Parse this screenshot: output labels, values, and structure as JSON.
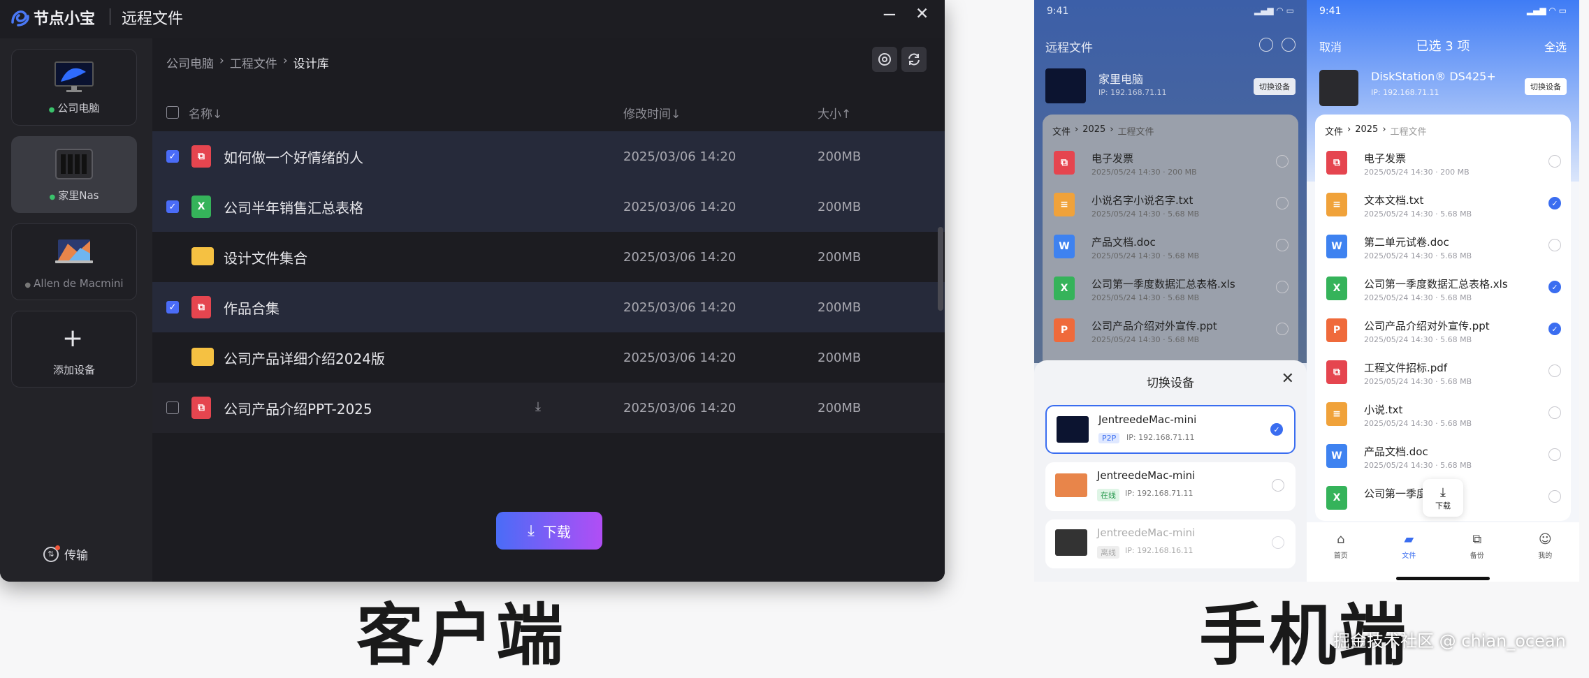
{
  "desktop": {
    "app_name": "节点小宝",
    "window_title": "远程文件",
    "min_label": "−",
    "close_label": "✕",
    "devices": [
      {
        "name": "公司电脑",
        "status": "online"
      },
      {
        "name": "家里Nas",
        "status": "online"
      },
      {
        "name": "Allen de Macmini",
        "status": "offline"
      }
    ],
    "add_device_label": "添加设备",
    "transfer_label": "传输",
    "breadcrumb": [
      "公司电脑",
      "工程文件",
      "设计库"
    ],
    "columns": {
      "name": "名称↓",
      "modified": "修改时间↓",
      "size": "大小↑"
    },
    "files": [
      {
        "name": "如何做一个好情绪的人",
        "type": "pdf",
        "time": "2025/03/06 14:20",
        "size": "200MB",
        "checked": true
      },
      {
        "name": "公司半年销售汇总表格",
        "type": "xls",
        "time": "2025/03/06 14:20",
        "size": "200MB",
        "checked": true
      },
      {
        "name": "设计文件集合",
        "type": "folder",
        "time": "2025/03/06 14:20",
        "size": "200MB",
        "checked": false
      },
      {
        "name": "作品合集",
        "type": "pdf",
        "time": "2025/03/06 14:20",
        "size": "200MB",
        "checked": true
      },
      {
        "name": "公司产品详细介绍2024版",
        "type": "folder",
        "time": "2025/03/06 14:20",
        "size": "200MB",
        "checked": false
      },
      {
        "name": "公司产品介绍PPT-2025",
        "type": "pdf",
        "time": "2025/03/06 14:20",
        "size": "200MB",
        "checked": false
      }
    ],
    "download_label": "下载",
    "accent": "#4a6cf7"
  },
  "phone1": {
    "time": "9:41",
    "title": "远程文件",
    "device_name": "家里电脑",
    "device_ip": "IP: 192.168.71.11",
    "switch_label": "切换设备",
    "crumbs": [
      "文件",
      "2025",
      "工程文件"
    ],
    "files": [
      {
        "name": "电子发票",
        "meta": "2025/05/24 14:30 · 200 MB",
        "color": "red",
        "glyph": "⧉"
      },
      {
        "name": "小说名字小说名字.txt",
        "meta": "2025/05/24 14:30 · 5.68 MB",
        "color": "orange",
        "glyph": "≡"
      },
      {
        "name": "产品文档.doc",
        "meta": "2025/05/24 14:30 · 5.68 MB",
        "color": "blue",
        "glyph": "W"
      },
      {
        "name": "公司第一季度数据汇总表格.xls",
        "meta": "2025/05/24 14:30 · 5.68 MB",
        "color": "green",
        "glyph": "X"
      },
      {
        "name": "公司产品介绍对外宣传.ppt",
        "meta": "2025/05/24 14:30 · 5.68 MB",
        "color": "ppt",
        "glyph": "P"
      }
    ],
    "sheet_title": "切换设备",
    "sheet_devices": [
      {
        "name": "JentreedeMac-mini",
        "tag": "P2P",
        "ip": "IP: 192.168.71.11",
        "selected": true
      },
      {
        "name": "JentreedeMac-mini",
        "tag": "在线",
        "ip": "IP: 192.168.71.11",
        "selected": false
      },
      {
        "name": "JentreedeMac-mini",
        "tag": "离线",
        "ip": "IP: 192.168.16.11",
        "selected": false
      }
    ]
  },
  "phone2": {
    "time": "9:41",
    "cancel": "取消",
    "selected_count": "已选 3 项",
    "select_all": "全选",
    "device_name": "DiskStation® DS425+",
    "device_ip": "IP: 192.168.71.11",
    "switch_label": "切换设备",
    "crumbs": [
      "文件",
      "2025",
      "工程文件"
    ],
    "files": [
      {
        "name": "电子发票",
        "meta": "2025/05/24 14:30 · 200 MB",
        "color": "red",
        "glyph": "⧉",
        "on": false
      },
      {
        "name": "文本文档.txt",
        "meta": "2025/05/24 14:30 · 5.68 MB",
        "color": "orange",
        "glyph": "≡",
        "on": true
      },
      {
        "name": "第二单元试卷.doc",
        "meta": "2025/05/24 14:30 · 5.68 MB",
        "color": "blue",
        "glyph": "W",
        "on": false
      },
      {
        "name": "公司第一季度数据汇总表格.xls",
        "meta": "2025/05/24 14:30 · 5.68 MB",
        "color": "green",
        "glyph": "X",
        "on": true
      },
      {
        "name": "公司产品介绍对外宣传.ppt",
        "meta": "2025/05/24 14:30 · 5.68 MB",
        "color": "ppt",
        "glyph": "P",
        "on": true
      },
      {
        "name": "工程文件招标.pdf",
        "meta": "2025/05/24 14:30 · 5.68 MB",
        "color": "red",
        "glyph": "⧉",
        "on": false
      },
      {
        "name": "小说.txt",
        "meta": "2025/05/24 14:30 · 5.68 MB",
        "color": "orange",
        "glyph": "≡",
        "on": false
      },
      {
        "name": "产品文档.doc",
        "meta": "2025/05/24 14:30 · 5.68 MB",
        "color": "blue",
        "glyph": "W",
        "on": false
      },
      {
        "name": "公司第一季度",
        "meta": "",
        "color": "green",
        "glyph": "X",
        "on": false
      }
    ],
    "download_label": "下载",
    "tabs": [
      "首页",
      "文件",
      "备份",
      "我的"
    ]
  },
  "captions": {
    "client": "客户端",
    "mobile": "手机端",
    "watermark": "掘金技术社区 @ chian_ocean"
  }
}
